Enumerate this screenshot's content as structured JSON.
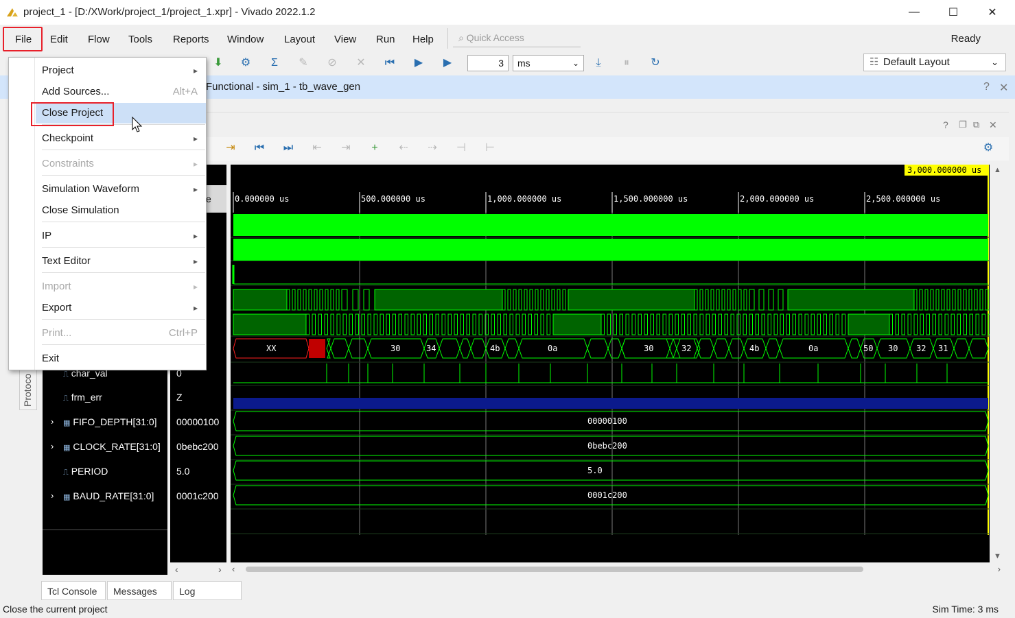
{
  "window": {
    "title": "project_1 - [D:/XWork/project_1/project_1.xpr] - Vivado 2022.1.2",
    "minimize": "—",
    "maximize": "☐",
    "close": "✕"
  },
  "menubar": {
    "items": [
      "File",
      "Edit",
      "Flow",
      "Tools",
      "Reports",
      "Window",
      "Layout",
      "View",
      "Run",
      "Help"
    ],
    "quick_access_placeholder": "Quick Access",
    "status": "Ready"
  },
  "toolbar": {
    "time_value": "3",
    "time_unit": "ms",
    "layout": "Default Layout"
  },
  "sim_band": {
    "title": "Functional - sim_1 - tb_wave_gen",
    "help": "?",
    "close": "✕"
  },
  "wave": {
    "value_header": "e",
    "cursor_time": "3,000.000000 us",
    "time_ticks": [
      "0.000000 us",
      "500.000000 us",
      "1,000.000000 us",
      "1,500.000000 us",
      "2,000.000000 us",
      "2,500.000000 us"
    ],
    "signals": [
      {
        "name": "char_val",
        "value": "0",
        "type": "bit",
        "expandable": false
      },
      {
        "name": "frm_err",
        "value": "Z",
        "type": "bit",
        "expandable": false
      },
      {
        "name": "FIFO_DEPTH[31:0]",
        "value": "00000100",
        "type": "bus",
        "expandable": true
      },
      {
        "name": "CLOCK_RATE[31:0]",
        "value": "0bebc200",
        "type": "bus",
        "expandable": true
      },
      {
        "name": "PERIOD",
        "value": "5.0",
        "type": "bit",
        "expandable": false
      },
      {
        "name": "BAUD_RATE[31:0]",
        "value": "0001c200",
        "type": "bus",
        "expandable": true
      }
    ],
    "bus_labels": [
      "00000100",
      "0bebc200",
      "5.0",
      "0001c200"
    ],
    "data_bus_labels": [
      "XX",
      "30",
      "34",
      "4b",
      "0a",
      "30",
      "32",
      "4b",
      "0a",
      "50",
      "30",
      "32",
      "31"
    ]
  },
  "menu": {
    "items": [
      {
        "label": "Project",
        "submenu": true,
        "disabled": false
      },
      {
        "label": "Add Sources...",
        "shortcut": "Alt+A",
        "disabled": false
      },
      {
        "label": "Close Project",
        "disabled": false,
        "highlighted": true
      },
      {
        "label": "Checkpoint",
        "submenu": true,
        "disabled": false
      },
      {
        "label": "Constraints",
        "submenu": true,
        "disabled": true
      },
      {
        "label": "Simulation Waveform",
        "submenu": true,
        "disabled": false
      },
      {
        "label": "Close Simulation",
        "disabled": false
      },
      {
        "label": "IP",
        "submenu": true,
        "disabled": false
      },
      {
        "label": "Text Editor",
        "submenu": true,
        "disabled": false
      },
      {
        "label": "Import",
        "submenu": true,
        "disabled": true
      },
      {
        "label": "Export",
        "submenu": true,
        "disabled": false
      },
      {
        "label": "Print...",
        "shortcut": "Ctrl+P",
        "disabled": true
      },
      {
        "label": "Exit",
        "disabled": false
      }
    ]
  },
  "side_tab": "Protoco",
  "bottom_tabs": [
    "Tcl Console",
    "Messages",
    "Log"
  ],
  "statusbar": {
    "left": "Close the current project",
    "right": "Sim Time: 3 ms"
  },
  "colors": {
    "accent_red": "#e8202a",
    "wave_green": "#00ff00",
    "wave_dark_green": "#006400",
    "menu_highlight": "#cde0f7",
    "sim_band": "#d3e5fb"
  }
}
